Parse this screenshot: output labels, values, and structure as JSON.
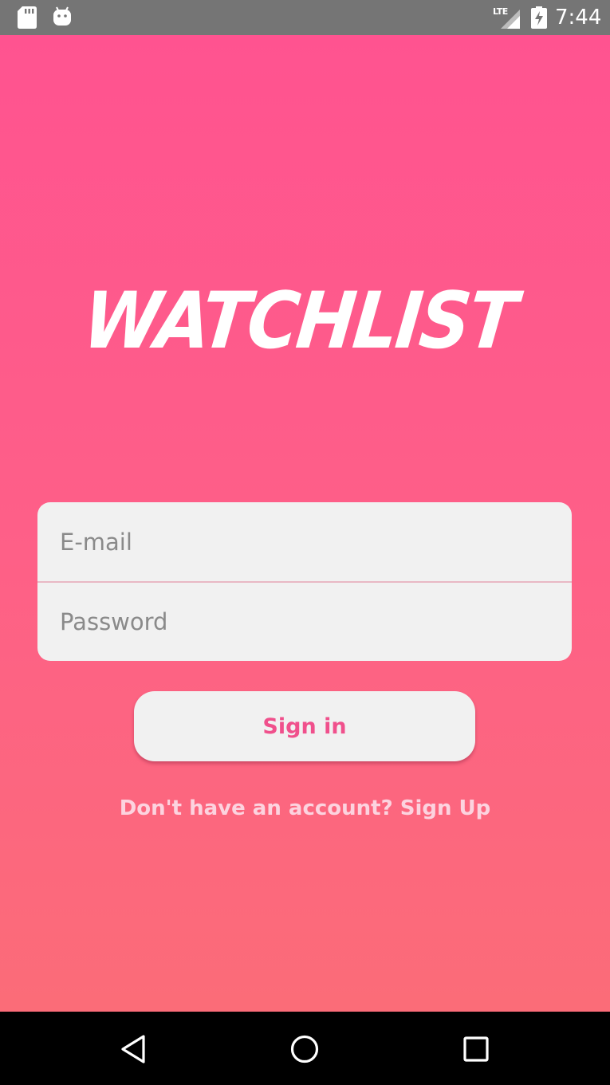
{
  "status_bar": {
    "time": "7:44",
    "network_label": "LTE",
    "icons": [
      "sd-card-icon",
      "android-icon",
      "lte-signal-icon",
      "battery-charging-icon"
    ]
  },
  "app": {
    "logo_text": "WATCHLIST",
    "email_placeholder": "E-mail",
    "password_placeholder": "Password",
    "signin_label": "Sign in",
    "signup_text": "Don't have an account? Sign Up",
    "colors": {
      "gradient_top": "#ff5390",
      "gradient_bottom": "#fb6c78",
      "button_text": "#f0508c",
      "card_bg": "#f1f1f1"
    }
  },
  "nav_bar": {
    "buttons": [
      "back-icon",
      "home-icon",
      "recents-icon"
    ]
  }
}
